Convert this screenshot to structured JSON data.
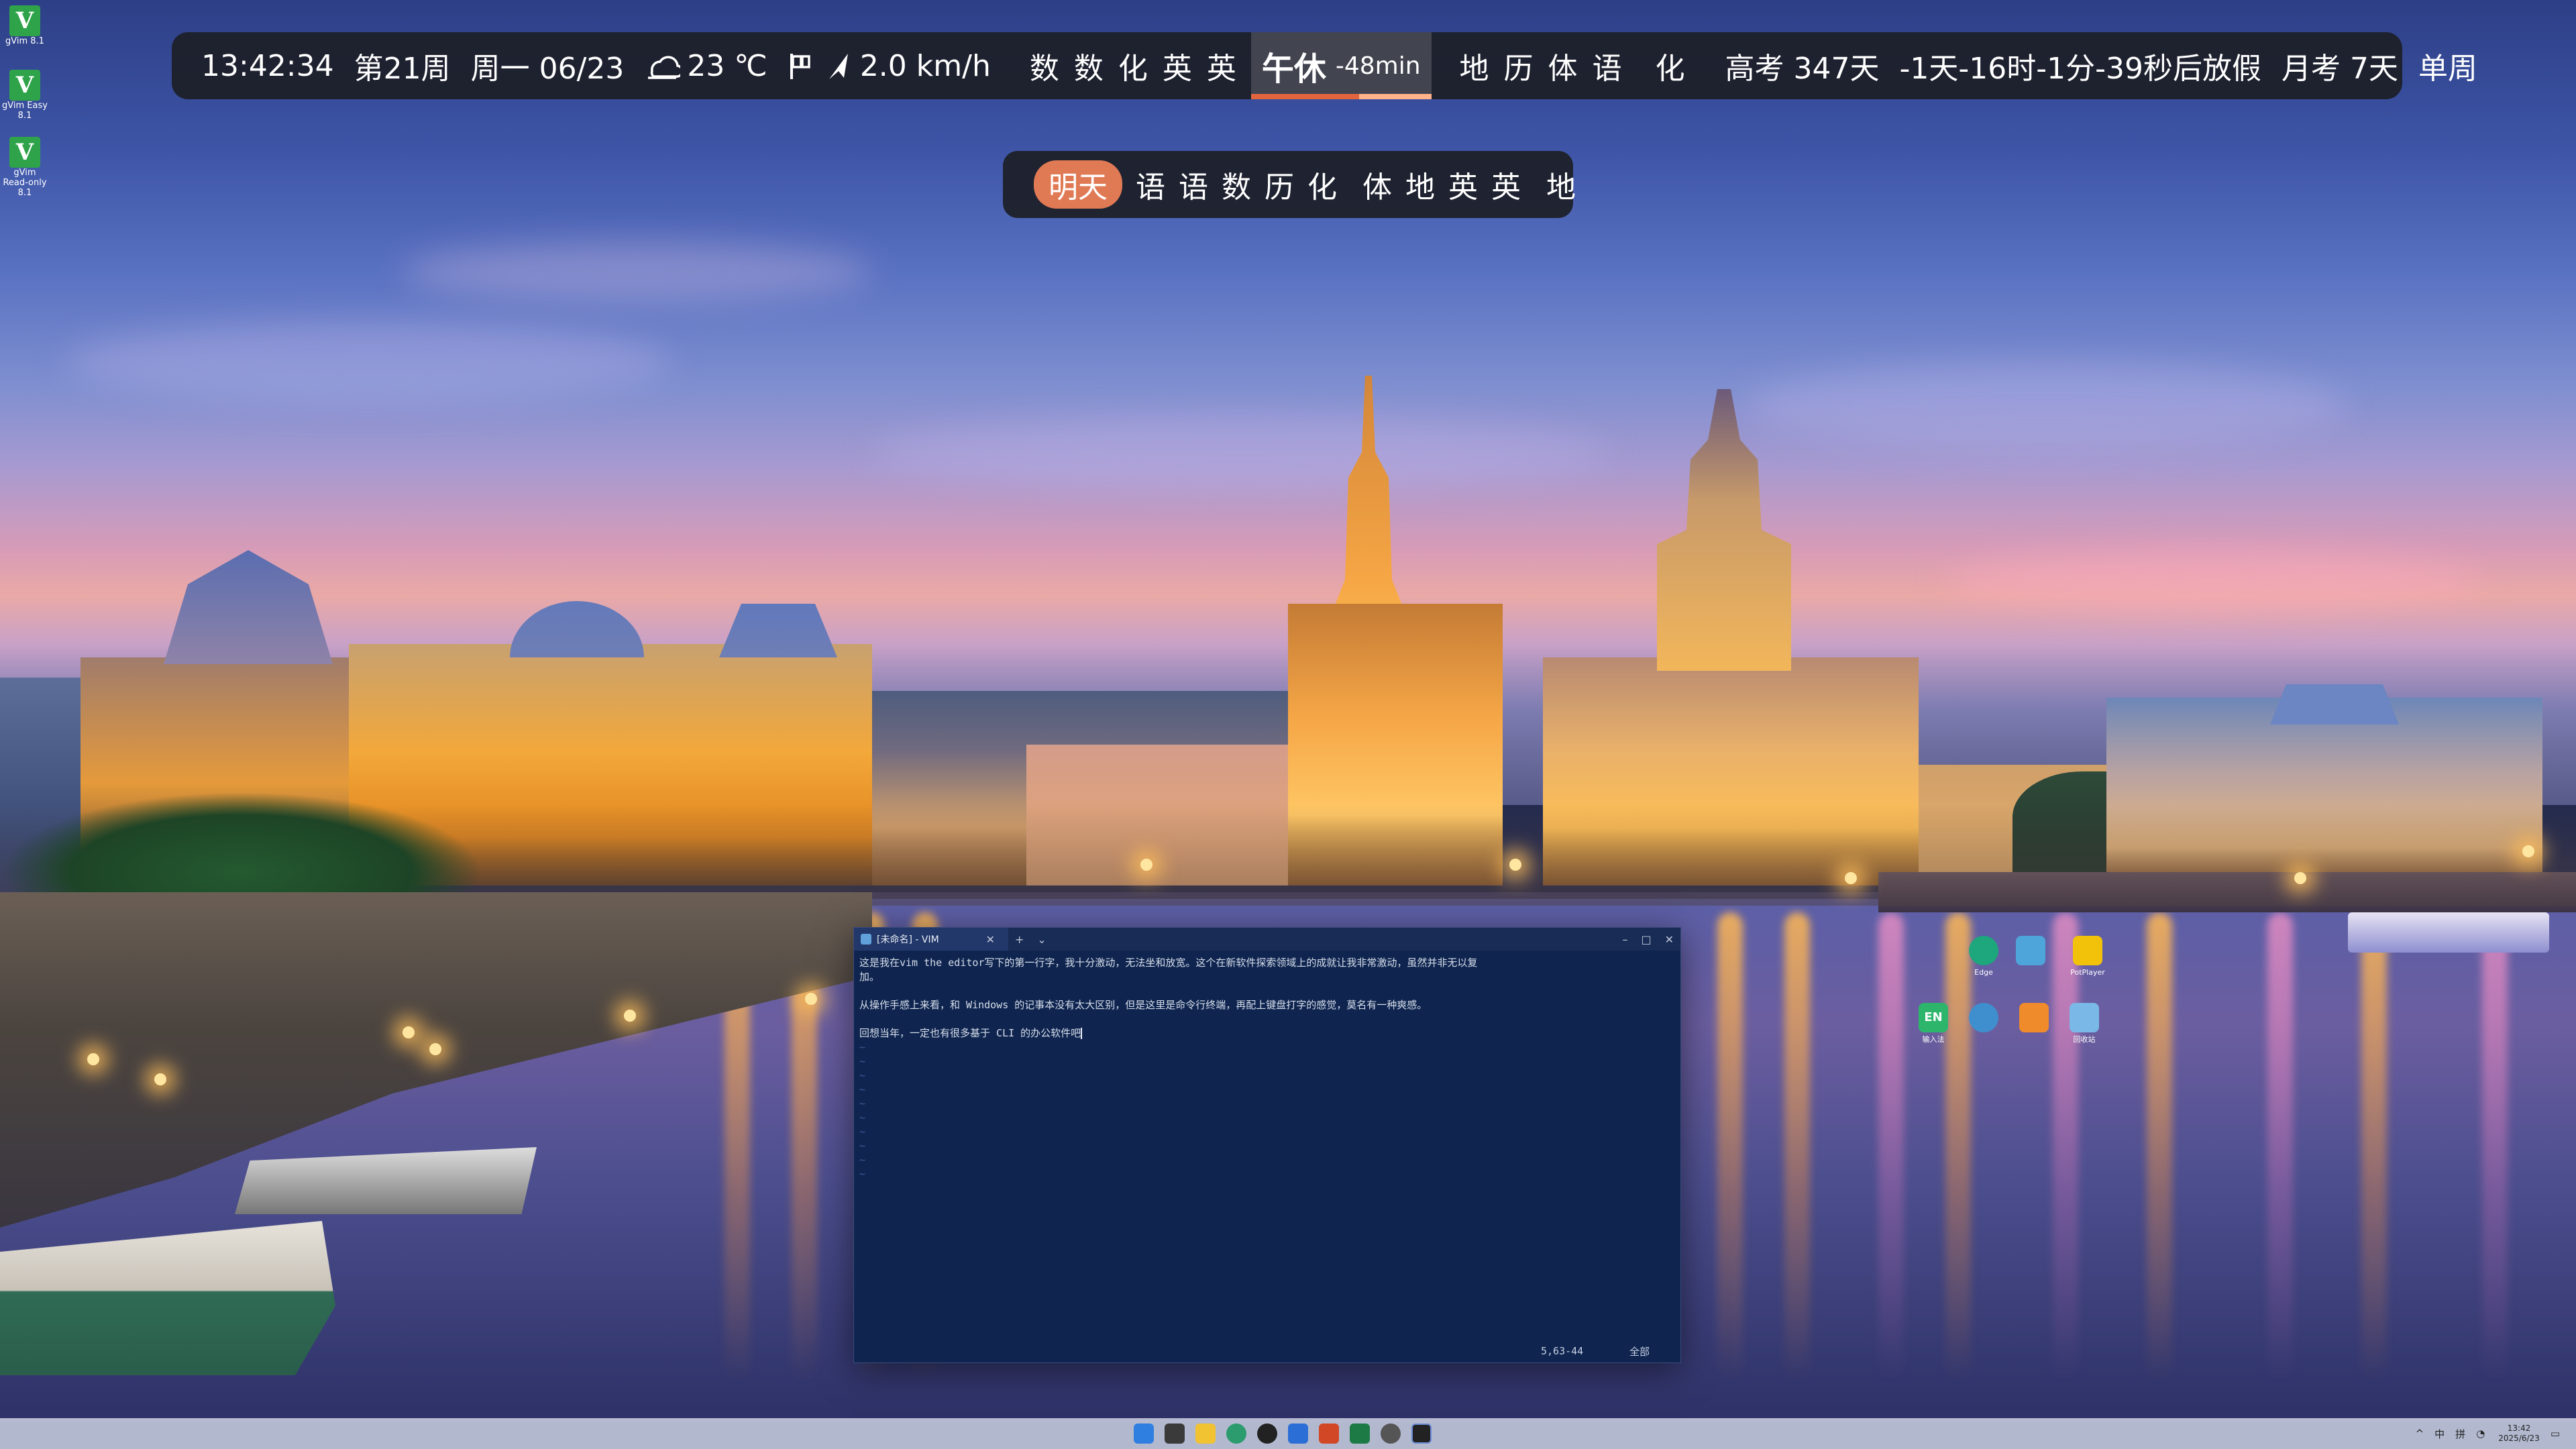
{
  "desktop": {
    "left_icons": [
      {
        "label": "gVim 8.1"
      },
      {
        "label": "gVim Easy 8.1"
      },
      {
        "label": "gVim Read-only 8.1"
      }
    ],
    "right_icons_row1": [
      {
        "label": "Edge",
        "color": "#1ea67c"
      },
      {
        "label": "",
        "color": "#4ea5d9"
      },
      {
        "label": "PotPlayer",
        "color": "#f2c20b"
      }
    ],
    "right_icons_row2": [
      {
        "label": "输入法",
        "color": "#2db56b"
      },
      {
        "label": "",
        "color": "#3f8fcf"
      },
      {
        "label": "",
        "color": "#f08b2c"
      },
      {
        "label": "回收站",
        "color": "#7ab8e8"
      }
    ]
  },
  "topbar": {
    "time": "13:42:34",
    "week": "第21周",
    "date": "周一 06/23",
    "weather_icon": "cloud-sun-icon",
    "temperature": "23 ℃",
    "wind_icon": "wind-flag-icon",
    "wind": "2.0 km/h",
    "morning_classes": [
      "数",
      "数",
      "化",
      "英",
      "英"
    ],
    "current_period": {
      "label": "午休",
      "remaining": "-48min",
      "progress": 0.6
    },
    "afternoon_classes": [
      "地",
      "历",
      "体",
      "语"
    ],
    "evening_classes": [
      "化"
    ],
    "gaokao": "高考 347天",
    "holiday_countdown": "-1天-16时-1分-39秒后放假",
    "monthly_exam": "月考 7天",
    "week_type": "单周",
    "accent_color": "#e2653d"
  },
  "tomorrow": {
    "badge": "明天",
    "group1": [
      "语",
      "语",
      "数",
      "历",
      "化"
    ],
    "group2": [
      "体",
      "地",
      "英",
      "英"
    ],
    "group3": [
      "地"
    ],
    "badge_color": "#e07a55"
  },
  "vim": {
    "tab_title": "[未命名] - VIM",
    "lines": [
      "这是我在vim the editor写下的第一行字，我十分激动，无法坐和放宽。这个在新软件探索领域上的成就让我非常激动，虽然并非无以复",
      "加。",
      "",
      "从操作手感上来看，和 Windows 的记事本没有太大区别，但是这里是命令行终端，再配上键盘打字的感觉，莫名有一种爽感。",
      "",
      "回想当年，一定也有很多基于 CLI 的办公软件吧"
    ],
    "tilde_count": 10,
    "cursor_pos": "5,63-44",
    "scroll_pct": "全部",
    "bg_color": "#0f2550"
  },
  "taskbar": {
    "tray_labels": [
      "^",
      "中",
      "拼"
    ],
    "clock_time": "13:42",
    "clock_date": "2025/6/23"
  }
}
